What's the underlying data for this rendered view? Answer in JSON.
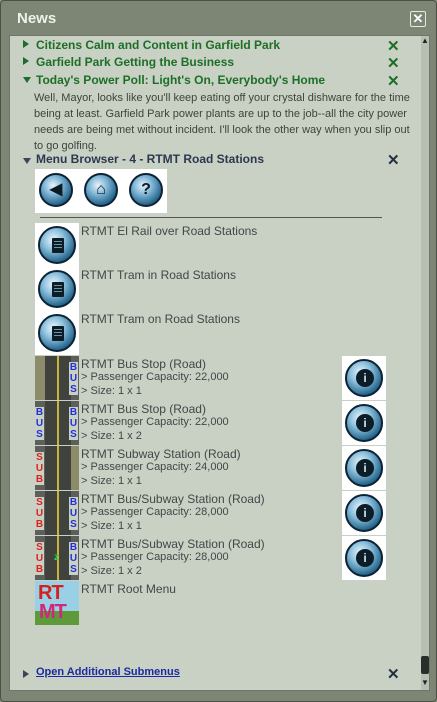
{
  "window": {
    "title": "News",
    "close_glyph": "✕"
  },
  "news": [
    {
      "title": "Citizens Calm and Content in Garfield Park",
      "expanded": false
    },
    {
      "title": "Garfield Park Getting the Business",
      "expanded": false
    },
    {
      "title": "Today's Power Poll: Light's On, Everybody's Home",
      "expanded": true,
      "body": "Well, Mayor, looks like you'll keep eating off your crystal dishware for the time being at least. Garfield Park power plants are up to the job--all the city power needs are being met without incident. I'll look the other way when you slip out to go golfing."
    }
  ],
  "close_x": "✕",
  "menu": {
    "title": "Menu Browser - 4 - RTMT Road Stations",
    "nav": [
      {
        "name": "back",
        "glyph": "◀"
      },
      {
        "name": "home",
        "glyph": "⌂"
      },
      {
        "name": "help",
        "glyph": "?"
      }
    ],
    "items": [
      {
        "label": "RTMT El Rail over Road Stations",
        "icon": "submenu-icon"
      },
      {
        "label": "RTMT Tram in Road Stations",
        "icon": "submenu-icon"
      },
      {
        "label": "RTMT Tram on Road Stations",
        "icon": "submenu-icon"
      },
      {
        "label": "RTMT Bus Stop (Road)",
        "capacity": "> Passenger Capacity: 22,000",
        "size": "> Size: 1 x 1",
        "icon": "bus-stop-1x1-icon"
      },
      {
        "label": "RTMT Bus Stop (Road)",
        "capacity": "> Passenger Capacity: 22,000",
        "size": "> Size: 1 x 2",
        "icon": "bus-stop-1x2-icon"
      },
      {
        "label": "RTMT Subway Station (Road)",
        "capacity": "> Passenger Capacity: 24,000",
        "size": "> Size: 1 x 1",
        "icon": "subway-station-icon"
      },
      {
        "label": "RTMT Bus/Subway Station (Road)",
        "capacity": "> Passenger Capacity: 28,000",
        "size": "> Size: 1 x 1",
        "icon": "bus-subway-1x1-icon"
      },
      {
        "label": "RTMT Bus/Subway Station (Road)",
        "capacity": "> Passenger Capacity: 28,000",
        "size": "> Size: 1 x 2",
        "icon": "bus-subway-1x2-icon"
      },
      {
        "label": "RTMT Root Menu",
        "icon": "rtmt-logo-icon"
      }
    ],
    "icon_text": {
      "bus": "BUS",
      "sub": "SUB",
      "logo_top": "RT",
      "logo_bottom": "MT",
      "z": "z"
    },
    "info_glyph": "i"
  },
  "footer": {
    "link": "Open Additional Submenus"
  },
  "colors": {
    "news_green": "#1c6f26",
    "menu_blue": "#2b3850",
    "panel": "#c9d0c4"
  }
}
